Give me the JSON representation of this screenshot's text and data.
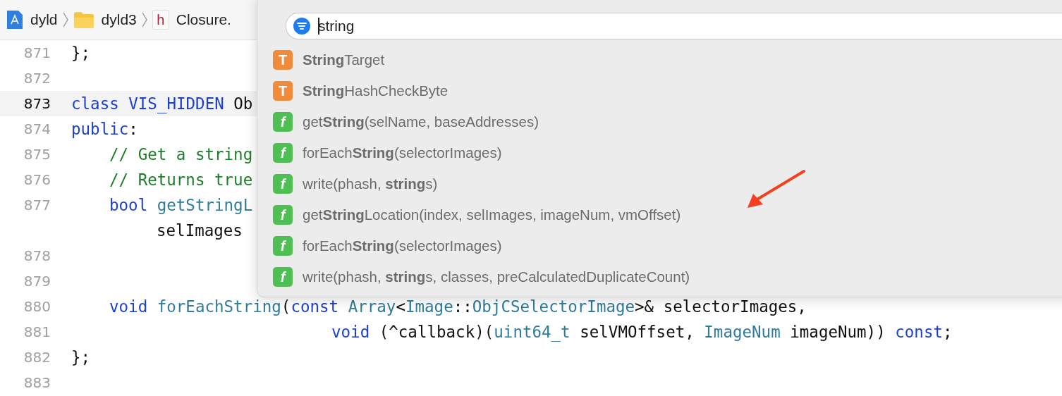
{
  "breadcrumbs": [
    {
      "kind": "project",
      "label": "dyld"
    },
    {
      "kind": "folder",
      "label": "dyld3"
    },
    {
      "kind": "header",
      "badge": "h",
      "label": "Closure."
    }
  ],
  "code_lines": [
    {
      "number": "871",
      "current": false,
      "kind": "top",
      "segments": [
        {
          "kind": "plain",
          "text": "};"
        }
      ]
    },
    {
      "number": "872",
      "current": false,
      "kind": "top"
    },
    {
      "number": "873",
      "current": true,
      "kind": "top",
      "segments": [
        {
          "kind": "keyword",
          "text": "class"
        },
        {
          "kind": "keyword",
          "text": " VIS_HIDDEN"
        },
        {
          "kind": "plain",
          "text": " Ob"
        }
      ]
    },
    {
      "number": "874",
      "current": false,
      "kind": "top",
      "segments": [
        {
          "kind": "keyword",
          "text": "public"
        },
        {
          "kind": "plain",
          "text": ":"
        }
      ]
    },
    {
      "number": "875",
      "current": false,
      "kind": "member",
      "segments": [
        {
          "kind": "comment",
          "text": "// Get a string"
        }
      ]
    },
    {
      "number": "876",
      "current": false,
      "kind": "member",
      "segments": [
        {
          "kind": "comment",
          "text": "// Returns true"
        }
      ]
    },
    {
      "number": "877",
      "current": false,
      "kind": "member",
      "segments": [
        {
          "kind": "keyword",
          "text": "bool"
        },
        {
          "kind": "type",
          "text": " getStringL"
        }
      ],
      "continuation": "selImages"
    },
    {
      "number": "878",
      "current": false,
      "kind": "member"
    },
    {
      "number": "879",
      "current": false,
      "kind": "member"
    },
    {
      "number": "880",
      "current": false,
      "kind": "member",
      "segments": [
        {
          "kind": "keyword",
          "text": "void"
        },
        {
          "kind": "type",
          "text": " forEachString"
        },
        {
          "kind": "plain",
          "text": "("
        },
        {
          "kind": "keyword",
          "text": "const"
        },
        {
          "kind": "type",
          "text": " Array"
        },
        {
          "kind": "plain",
          "text": "<"
        },
        {
          "kind": "type",
          "text": "Image"
        },
        {
          "kind": "plain",
          "text": "::"
        },
        {
          "kind": "type",
          "text": "ObjCSelectorImage"
        },
        {
          "kind": "plain",
          "text": ">& selectorImages,"
        }
      ]
    },
    {
      "number": "881",
      "current": false,
      "kind": "wrapped",
      "segments": [
        {
          "kind": "keyword",
          "text": "void"
        },
        {
          "kind": "plain",
          "text": " (^callback)("
        },
        {
          "kind": "type",
          "text": "uint64_t"
        },
        {
          "kind": "plain",
          "text": " selVMOffset, "
        },
        {
          "kind": "type",
          "text": "ImageNum"
        },
        {
          "kind": "plain",
          "text": " imageNum)) "
        },
        {
          "kind": "keyword",
          "text": "const"
        },
        {
          "kind": "plain",
          "text": ";"
        }
      ]
    },
    {
      "number": "882",
      "current": false,
      "kind": "top",
      "segments": [
        {
          "kind": "plain",
          "text": "};"
        }
      ]
    },
    {
      "number": "883",
      "current": false,
      "kind": "top"
    }
  ],
  "completion_popup": {
    "search": {
      "value": "string"
    },
    "items": [
      {
        "kind": "type",
        "badge": "T",
        "label": "**String**Target"
      },
      {
        "kind": "type",
        "badge": "T",
        "label": "**String**HashCheckByte"
      },
      {
        "kind": "function",
        "badge": "f",
        "label": "get**String**(selName, baseAddresses)"
      },
      {
        "kind": "function",
        "badge": "f",
        "label": "forEach**String**(selectorImages)"
      },
      {
        "kind": "function",
        "badge": "f",
        "label": "write(phash, **string**s)"
      },
      {
        "kind": "function",
        "badge": "f",
        "label": "get**String**Location(index, selImages, imageNum, vmOffset)"
      },
      {
        "kind": "function",
        "badge": "f",
        "label": "forEach**String**(selectorImages)"
      },
      {
        "kind": "function",
        "badge": "f",
        "label": "write(phash, **string**s, classes, preCalculatedDuplicateCount)"
      }
    ]
  }
}
